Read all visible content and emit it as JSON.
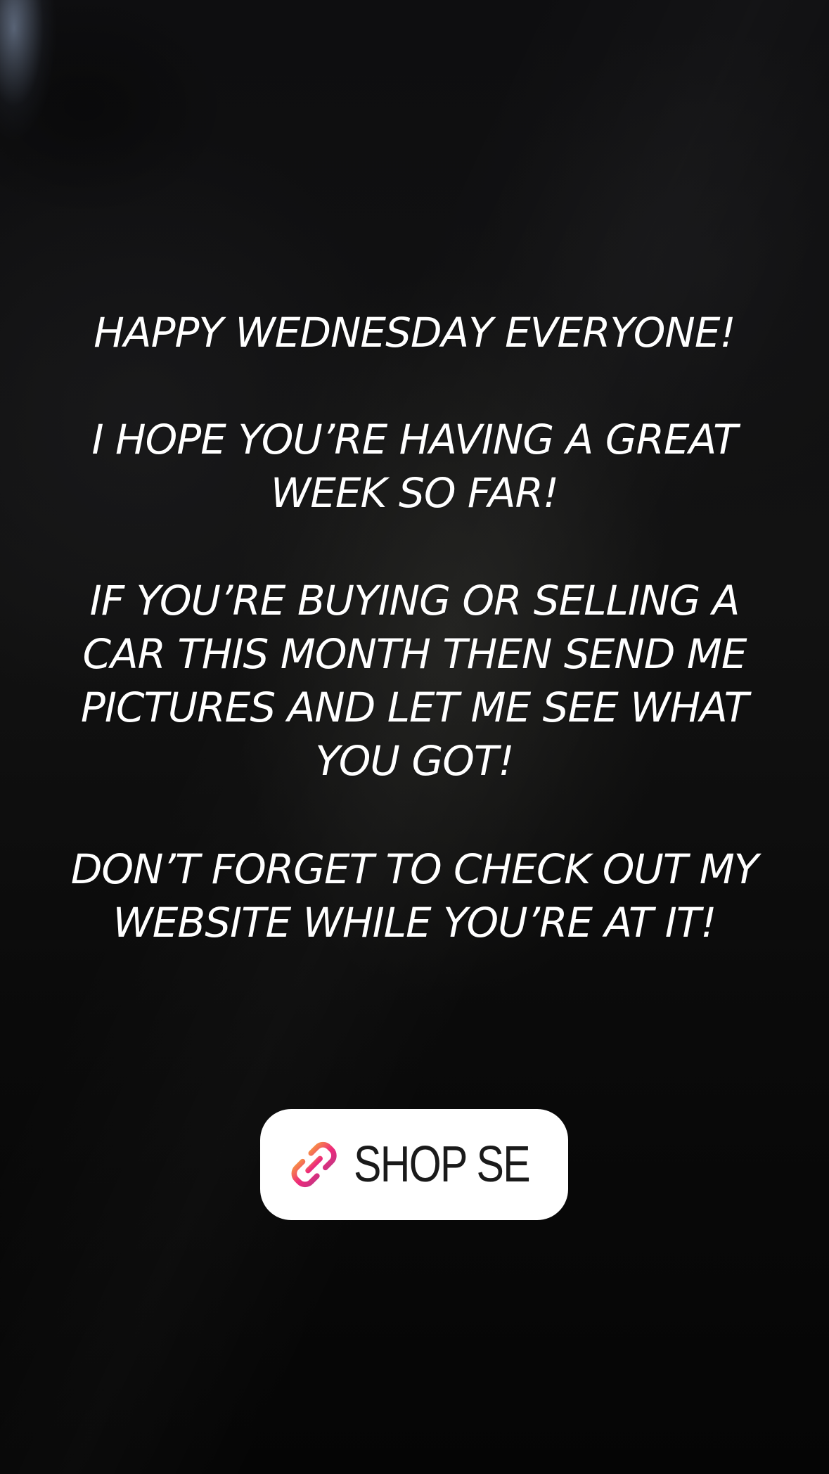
{
  "story": {
    "paragraphs": [
      "HAPPY WEDNESDAY EVERYONE!",
      "I HOPE YOU’RE HAVING A GREAT WEEK SO FAR!",
      "IF YOU’RE BUYING OR SELLING A CAR THIS MONTH THEN SEND ME PICTURES AND LET ME SEE WHAT YOU GOT!",
      "DON’T FORGET TO CHECK OUT MY WEBSITE WHILE YOU’RE AT IT!"
    ],
    "text_color": "#ffffff"
  },
  "link_sticker": {
    "label": "SHOP SE",
    "icon": "link-icon",
    "background": "#ffffff",
    "icon_gradient": [
      "#f9a23b",
      "#ee2a7b",
      "#c13584"
    ]
  }
}
